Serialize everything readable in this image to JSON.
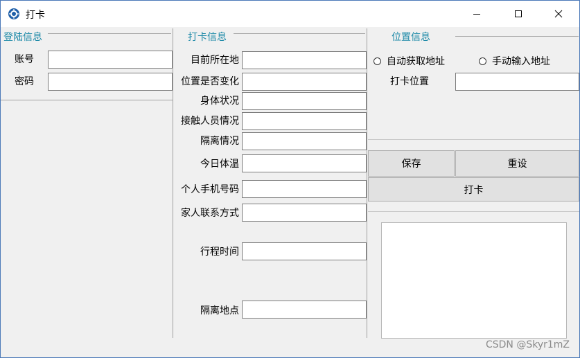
{
  "window": {
    "title": "打卡"
  },
  "login": {
    "title": "登陆信息",
    "account_label": "账号",
    "account_value": "",
    "password_label": "密码",
    "password_value": ""
  },
  "checkin": {
    "title": "打卡信息",
    "fields": [
      {
        "label": "目前所在地",
        "value": ""
      },
      {
        "label": "位置是否变化",
        "value": ""
      },
      {
        "label": "身体状况",
        "value": ""
      },
      {
        "label": "接触人员情况",
        "value": ""
      },
      {
        "label": "隔离情况",
        "value": ""
      },
      {
        "label": "今日体温",
        "value": ""
      },
      {
        "label": "个人手机号码",
        "value": ""
      },
      {
        "label": "家人联系方式",
        "value": ""
      },
      {
        "label": "行程时间",
        "value": ""
      },
      {
        "label": "隔离地点",
        "value": ""
      }
    ]
  },
  "location": {
    "title": "位置信息",
    "auto_label": "自动获取地址",
    "manual_label": "手动输入地址",
    "position_label": "打卡位置",
    "position_value": ""
  },
  "actions": {
    "save": "保存",
    "reset": "重设",
    "checkin": "打卡"
  },
  "watermark": "CSDN @Skyr1mZ"
}
